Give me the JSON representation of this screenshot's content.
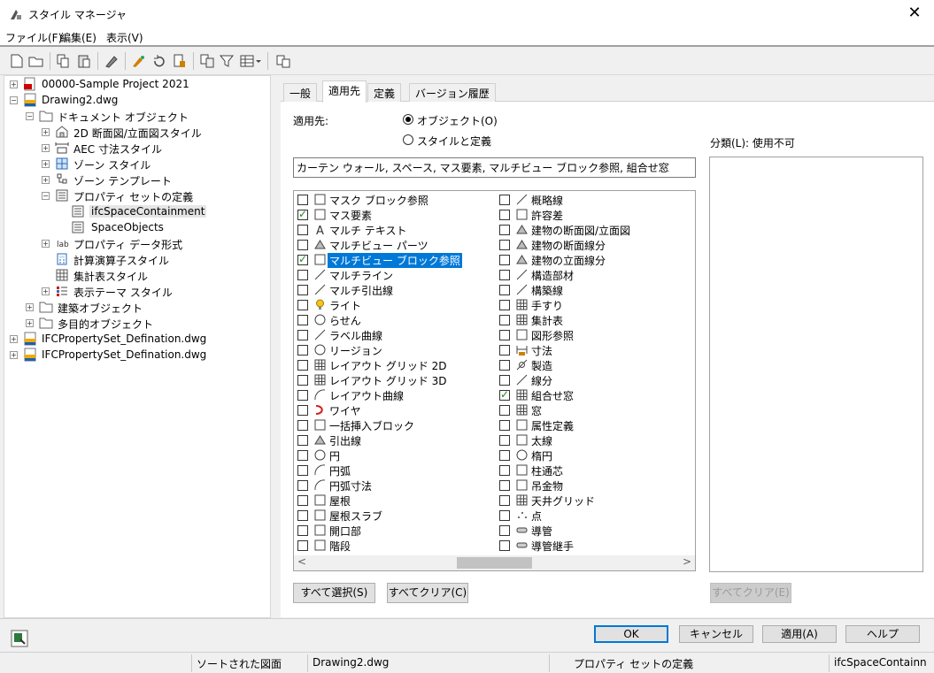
{
  "window": {
    "title": "スタイル マネージャ"
  },
  "menu": [
    "ファイル(F)",
    "編集(E)",
    "表示(V)"
  ],
  "tree": {
    "nodes": [
      "00000-Sample Project 2021",
      "Drawing2.dwg",
      "ドキュメント オブジェクト",
      "2D 断面図/立面図スタイル",
      "AEC 寸法スタイル",
      "ゾーン スタイル",
      "ゾーン テンプレート",
      "プロパティ セットの定義",
      "ifcSpaceContainment",
      "SpaceObjects",
      "プロパティ データ形式",
      "計算演算子スタイル",
      "集計表スタイル",
      "表示テーマ スタイル",
      "建築オブジェクト",
      "多目的オブジェクト",
      "IFCPropertySet_Defination.dwg",
      "IFCPropertySet_Defination.dwg"
    ]
  },
  "tabs": [
    "一般",
    "適用先",
    "定義",
    "バージョン履歴"
  ],
  "applies": {
    "label": "適用先:",
    "radio_objects": "オブジェクト(O)",
    "radio_styles": "スタイルと定義",
    "summary": "カーテン ウォール, スペース, マス要素, マルチビュー ブロック参照, 組合せ窓",
    "col1": [
      {
        "label": "マスク ブロック参照",
        "checked": false
      },
      {
        "label": "マス要素",
        "checked": true
      },
      {
        "label": "マルチ テキスト",
        "checked": false
      },
      {
        "label": "マルチビュー パーツ",
        "checked": false
      },
      {
        "label": "マルチビュー ブロック参照",
        "checked": true
      },
      {
        "label": "マルチライン",
        "checked": false
      },
      {
        "label": "マルチ引出線",
        "checked": false
      },
      {
        "label": "ライト",
        "checked": false
      },
      {
        "label": "らせん",
        "checked": false
      },
      {
        "label": "ラベル曲線",
        "checked": false
      },
      {
        "label": "リージョン",
        "checked": false
      },
      {
        "label": "レイアウト グリッド 2D",
        "checked": false
      },
      {
        "label": "レイアウト グリッド 3D",
        "checked": false
      },
      {
        "label": "レイアウト曲線",
        "checked": false
      },
      {
        "label": "ワイヤ",
        "checked": false
      },
      {
        "label": "一括挿入ブロック",
        "checked": false
      },
      {
        "label": "引出線",
        "checked": false
      },
      {
        "label": "円",
        "checked": false
      },
      {
        "label": "円弧",
        "checked": false
      },
      {
        "label": "円弧寸法",
        "checked": false
      },
      {
        "label": "屋根",
        "checked": false
      },
      {
        "label": "屋根スラブ",
        "checked": false
      },
      {
        "label": "開口部",
        "checked": false
      },
      {
        "label": "階段",
        "checked": false
      }
    ],
    "col2": [
      {
        "label": "概略線",
        "checked": false
      },
      {
        "label": "許容差",
        "checked": false
      },
      {
        "label": "建物の断面図/立面図",
        "checked": false
      },
      {
        "label": "建物の断面線分",
        "checked": false
      },
      {
        "label": "建物の立面線分",
        "checked": false
      },
      {
        "label": "構造部材",
        "checked": false
      },
      {
        "label": "構築線",
        "checked": false
      },
      {
        "label": "手すり",
        "checked": false
      },
      {
        "label": "集計表",
        "checked": false
      },
      {
        "label": "図形参照",
        "checked": false
      },
      {
        "label": "寸法",
        "checked": false
      },
      {
        "label": "製造",
        "checked": false
      },
      {
        "label": "線分",
        "checked": false
      },
      {
        "label": "組合せ窓",
        "checked": true
      },
      {
        "label": "窓",
        "checked": false
      },
      {
        "label": "属性定義",
        "checked": false
      },
      {
        "label": "太線",
        "checked": false
      },
      {
        "label": "楕円",
        "checked": false
      },
      {
        "label": "柱通芯",
        "checked": false
      },
      {
        "label": "吊金物",
        "checked": false
      },
      {
        "label": "天井グリッド",
        "checked": false
      },
      {
        "label": "点",
        "checked": false
      },
      {
        "label": "導管",
        "checked": false
      },
      {
        "label": "導管継手",
        "checked": false
      }
    ],
    "select_all": "すべて選択(S)",
    "clear_all": "すべてクリア(C)",
    "classification_label": "分類(L): 使用不可",
    "clear_all_disabled": "すべてクリア(E)"
  },
  "dialog_buttons": {
    "ok": "OK",
    "cancel": "キャンセル",
    "apply": "適用(A)",
    "help": "ヘルプ"
  },
  "status": [
    "ソートされた図面",
    "Drawing2.dwg",
    "プロパティ セットの定義",
    "ifcSpaceContainn"
  ],
  "colors": {
    "selection": "#0078d7",
    "check": "#1a8a1a"
  }
}
